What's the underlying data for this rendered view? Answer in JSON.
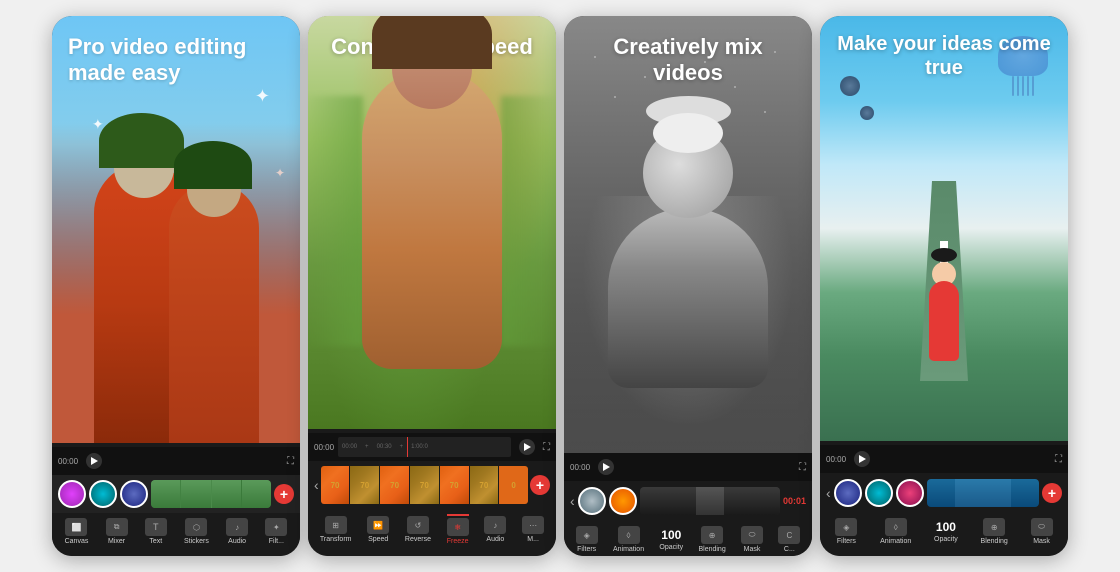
{
  "cards": [
    {
      "id": "card1",
      "title": "Pro video editing\nmade easy",
      "toolbar_items": [
        {
          "icon": "canvas-icon",
          "label": "Canvas"
        },
        {
          "icon": "mixer-icon",
          "label": "Mixer"
        },
        {
          "icon": "text-icon",
          "label": "Text"
        },
        {
          "icon": "stickers-icon",
          "label": "Stickers"
        },
        {
          "icon": "audio-icon",
          "label": "Audio"
        },
        {
          "icon": "filters-icon",
          "label": "Filt..."
        }
      ],
      "time": "00:00"
    },
    {
      "id": "card2",
      "title": "Control your\nspeed",
      "toolbar_items": [
        {
          "icon": "transform-icon",
          "label": "Transform"
        },
        {
          "icon": "speed-icon",
          "label": "Speed"
        },
        {
          "icon": "reverse-icon",
          "label": "Reverse"
        },
        {
          "icon": "freeze-icon",
          "label": "Freeze"
        },
        {
          "icon": "audio-icon",
          "label": "Audio"
        },
        {
          "icon": "more-icon",
          "label": "M..."
        }
      ],
      "time": "00:00"
    },
    {
      "id": "card3",
      "title": "Creatively mix\nvideos",
      "toolbar_items": [
        {
          "icon": "filters-icon",
          "label": "Filters"
        },
        {
          "icon": "animation-icon",
          "label": "Animation"
        },
        {
          "icon": "opacity-icon",
          "label": "Opacity"
        },
        {
          "icon": "blending-icon",
          "label": "Blending"
        },
        {
          "icon": "mask-icon",
          "label": "Mask"
        },
        {
          "icon": "more-icon",
          "label": "C..."
        }
      ],
      "time": "00:00",
      "opacity_value": "100"
    },
    {
      "id": "card4",
      "title": "Make your ideas\ncome true",
      "toolbar_items": [
        {
          "icon": "filters-icon",
          "label": "Filters"
        },
        {
          "icon": "animation-icon",
          "label": "Animation"
        },
        {
          "icon": "opacity-icon",
          "label": "Opacity"
        },
        {
          "icon": "blending-icon",
          "label": "Blending"
        },
        {
          "icon": "mask-icon",
          "label": "Mask"
        }
      ],
      "time": "00:00",
      "opacity_value": "100"
    }
  ],
  "accent_color": "#e53935",
  "bg_color": "#1a1a1a",
  "text_color_light": "#ffffff",
  "toolbar_label_color": "#cccccc"
}
